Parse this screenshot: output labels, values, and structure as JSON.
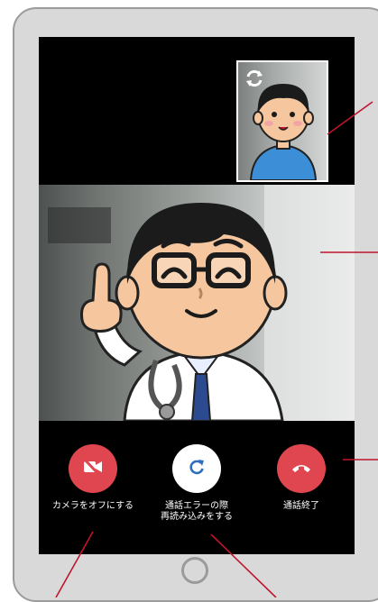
{
  "controls": {
    "camera_off_label": "カメラをオフにする",
    "reload_label": "通話エラーの際\n再読み込みをする",
    "end_call_label": "通話終了"
  },
  "icons": {
    "switch_camera": "switch-camera-icon",
    "camera_off": "video-off-icon",
    "reload": "refresh-icon",
    "end_call": "phone-hangup-icon"
  },
  "colors": {
    "end_call_red": "#e0464f",
    "annotation_red": "#c0152f",
    "screen_bg": "#000000",
    "frame_gray": "#d9d9d9"
  }
}
